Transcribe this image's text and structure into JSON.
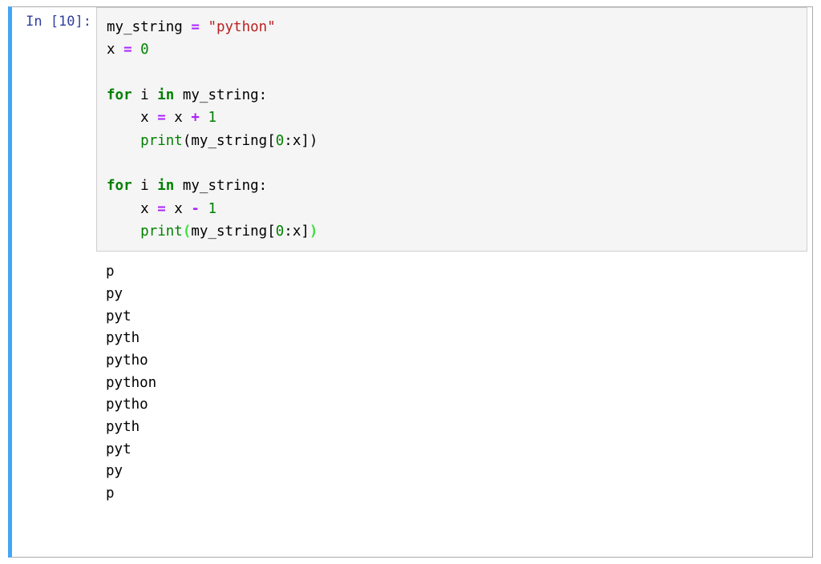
{
  "prompt": {
    "label": "In [10]:"
  },
  "code": {
    "line1_var": "my_string ",
    "line1_eq": "=",
    "line1_str": " \"python\"",
    "line2": "x ",
    "line2_eq": "=",
    "line2_val": " 0",
    "line3_for": "for",
    "line3_mid": " i ",
    "line3_in": "in",
    "line3_end": " my_string:",
    "line4_a": "    x ",
    "line4_eq": "=",
    "line4_b": " x ",
    "line4_op": "+",
    "line4_c": " ",
    "line4_num": "1",
    "line5_indent": "    ",
    "line5_print": "print",
    "line5_arg": "(my_string[",
    "line5_n0": "0",
    "line5_colon": ":x])",
    "line6_for": "for",
    "line6_mid": " i ",
    "line6_in": "in",
    "line6_end": " my_string:",
    "line7_a": "    x ",
    "line7_eq": "=",
    "line7_b": " x ",
    "line7_op": "-",
    "line7_c": " ",
    "line7_num": "1",
    "line8_indent": "    ",
    "line8_print": "print",
    "line8_open": "(",
    "line8_arg": "my_string[",
    "line8_n0": "0",
    "line8_colon": ":x]",
    "line8_close": ")"
  },
  "output": {
    "lines": "p\npy\npyt\npyth\npytho\npython\npytho\npyth\npyt\npy\np"
  }
}
